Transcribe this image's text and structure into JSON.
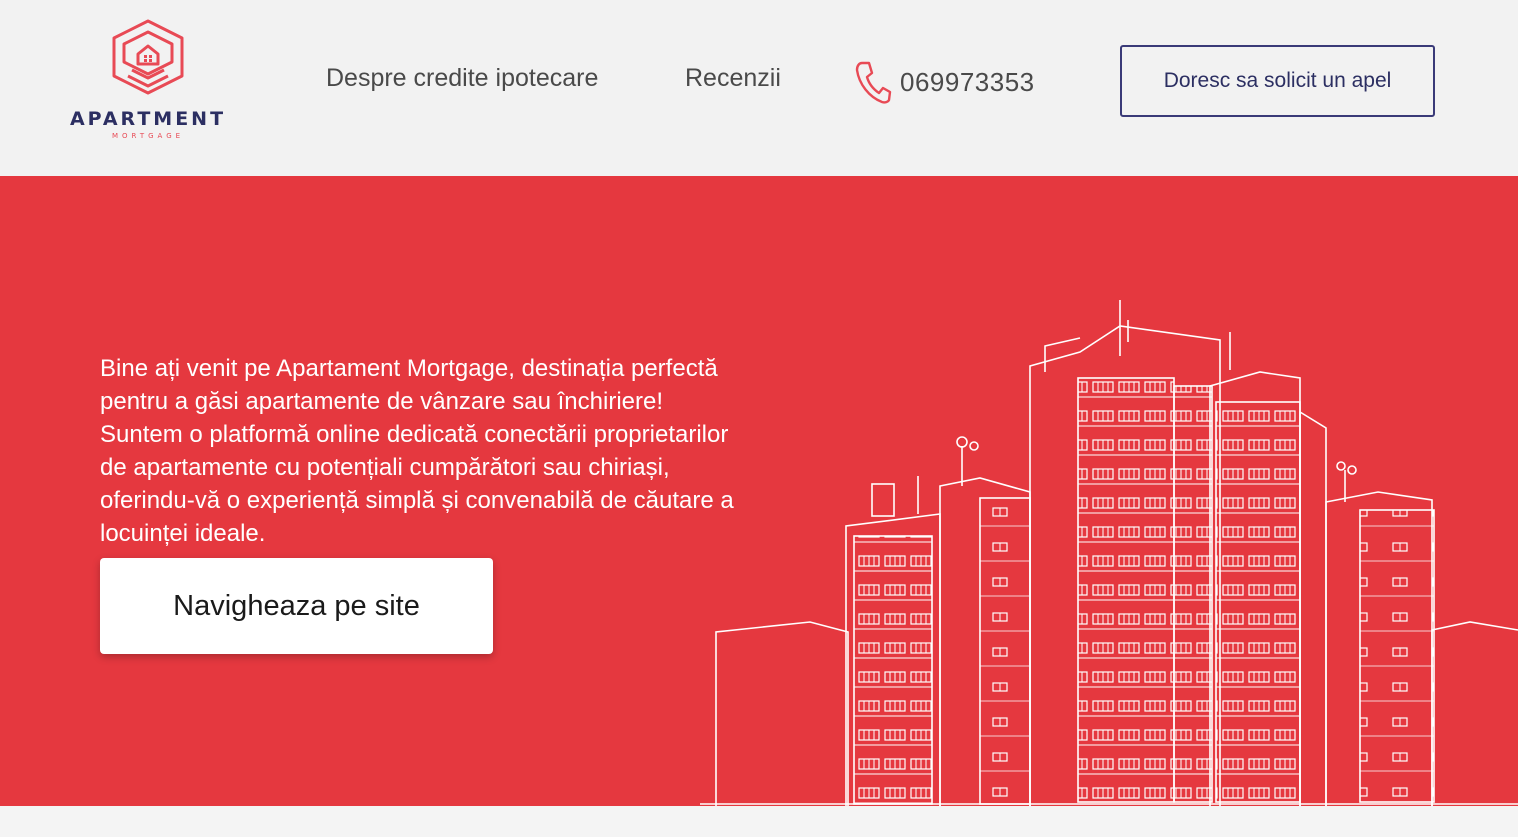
{
  "brand": {
    "name": "APARTMENT",
    "tagline": "MORTGAGE",
    "logo_icon": "house-hexagon-logo-icon",
    "colors": {
      "primary": "#e5383f",
      "navy": "#2c2f62"
    }
  },
  "nav": {
    "links": [
      {
        "label": "Despre credite ipotecare"
      },
      {
        "label": "Recenzii"
      }
    ],
    "phone": {
      "icon": "phone-icon",
      "number": "069973353"
    },
    "cta_label": "Doresc sa solicit un apel"
  },
  "hero": {
    "text": "Bine ați venit pe Apartament Mortgage, destinația perfectă pentru a găsi apartamente de vânzare sau închiriere! Suntem o platformă online dedicată conectării proprietarilor de apartamente cu potențiali cumpărători sau chiriași, oferindu-vă o experiență simplă și convenabilă de căutare a locuinței ideale.",
    "button_label": "Navigheaza pe site",
    "illustration": "city-buildings-illustration"
  }
}
